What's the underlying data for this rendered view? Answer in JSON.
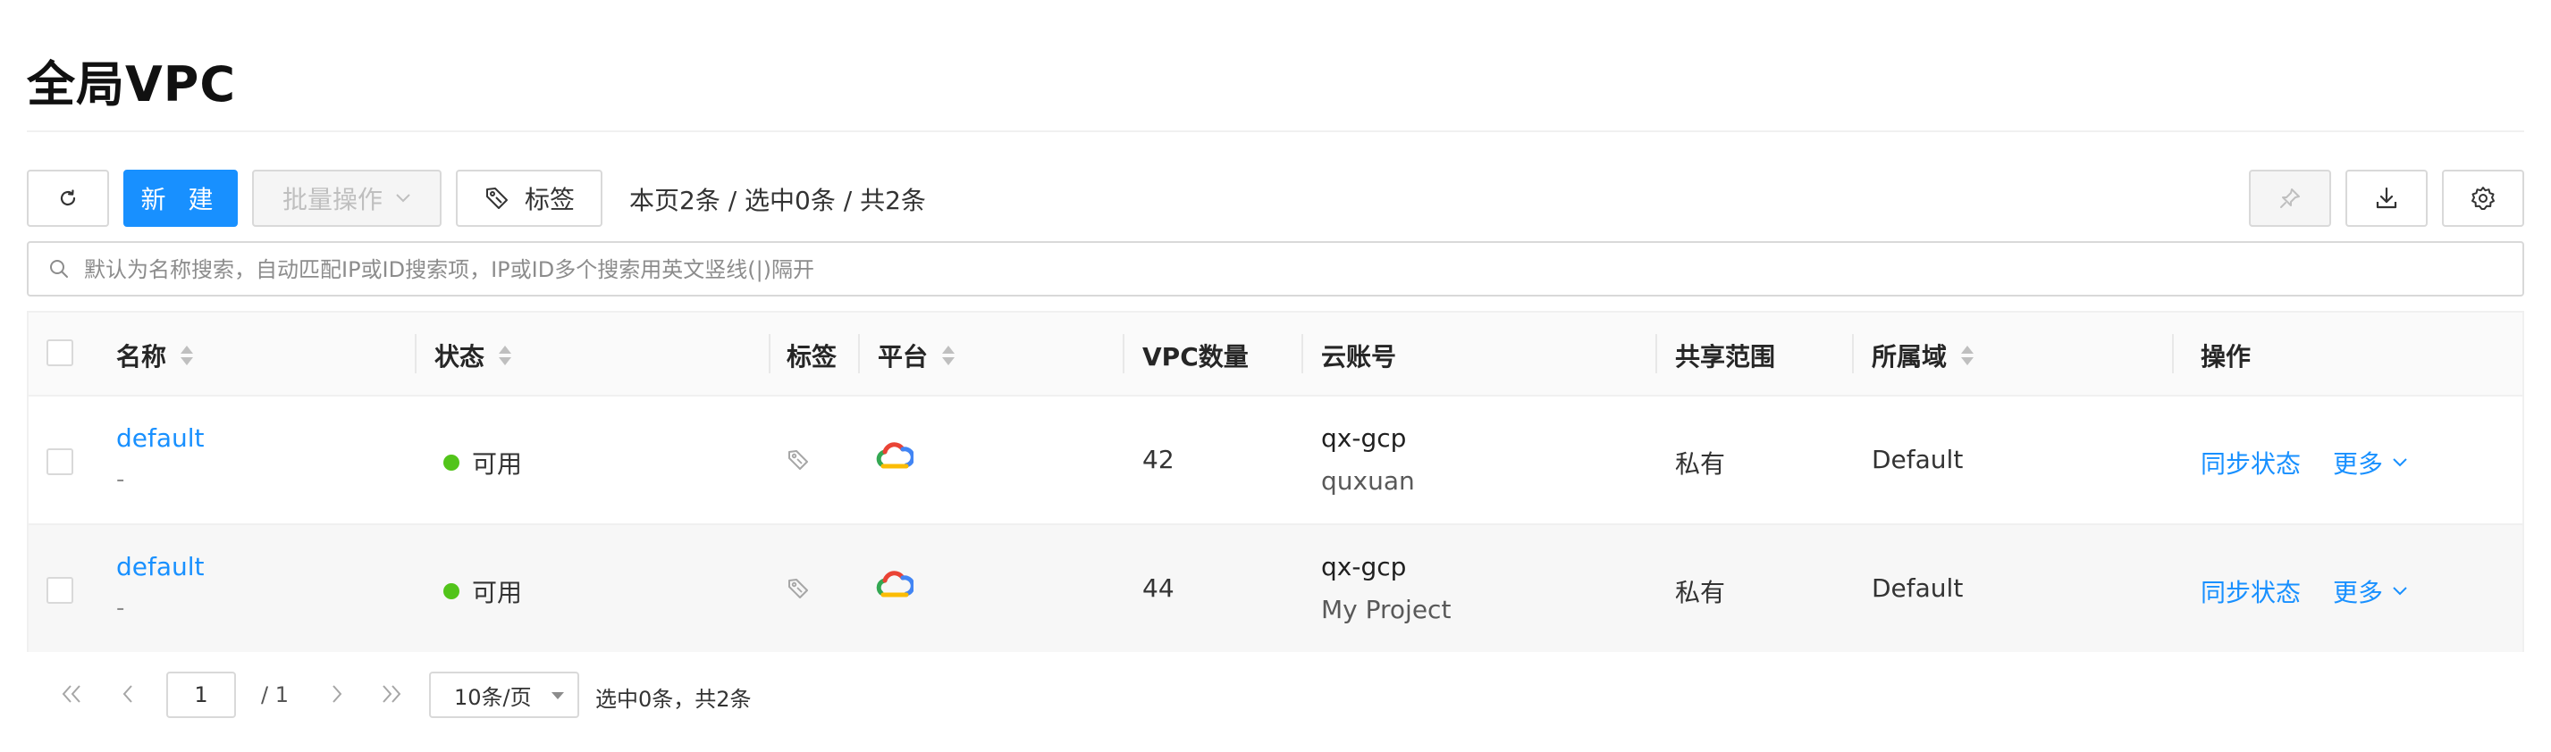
{
  "page": {
    "title": "全局VPC"
  },
  "toolbar": {
    "new_label": "新 建",
    "batch_label": "批量操作",
    "tag_label": "标签",
    "count_text": "本页2条 / 选中0条 / 共2条"
  },
  "search": {
    "placeholder": "默认为名称搜索，自动匹配IP或ID搜索项，IP或ID多个搜索用英文竖线(|)隔开",
    "value": ""
  },
  "table": {
    "columns": {
      "name": "名称",
      "status": "状态",
      "tags": "标签",
      "platform": "平台",
      "vpc_count": "VPC数量",
      "cloud_account": "云账号",
      "share_scope": "共享范围",
      "domain": "所属域",
      "actions": "操作"
    },
    "rows": [
      {
        "name": "default",
        "description": "-",
        "status": "可用",
        "platform_icon": "google-cloud-icon",
        "vpc_count": "42",
        "account": "qx-gcp",
        "account_sub": "quxuan",
        "share_scope": "私有",
        "domain": "Default",
        "sync_label": "同步状态",
        "more_label": "更多"
      },
      {
        "name": "default",
        "description": "-",
        "status": "可用",
        "platform_icon": "google-cloud-icon",
        "vpc_count": "44",
        "account": "qx-gcp",
        "account_sub": "My Project",
        "share_scope": "私有",
        "domain": "Default",
        "sync_label": "同步状态",
        "more_label": "更多"
      }
    ]
  },
  "pagination": {
    "current_page": "1",
    "total_pages": "/ 1",
    "page_size": "10条/页",
    "info": "选中0条，共2条"
  },
  "colors": {
    "primary": "#1890ff",
    "status_ok": "#52c41a",
    "border": "#d9d9d9"
  }
}
